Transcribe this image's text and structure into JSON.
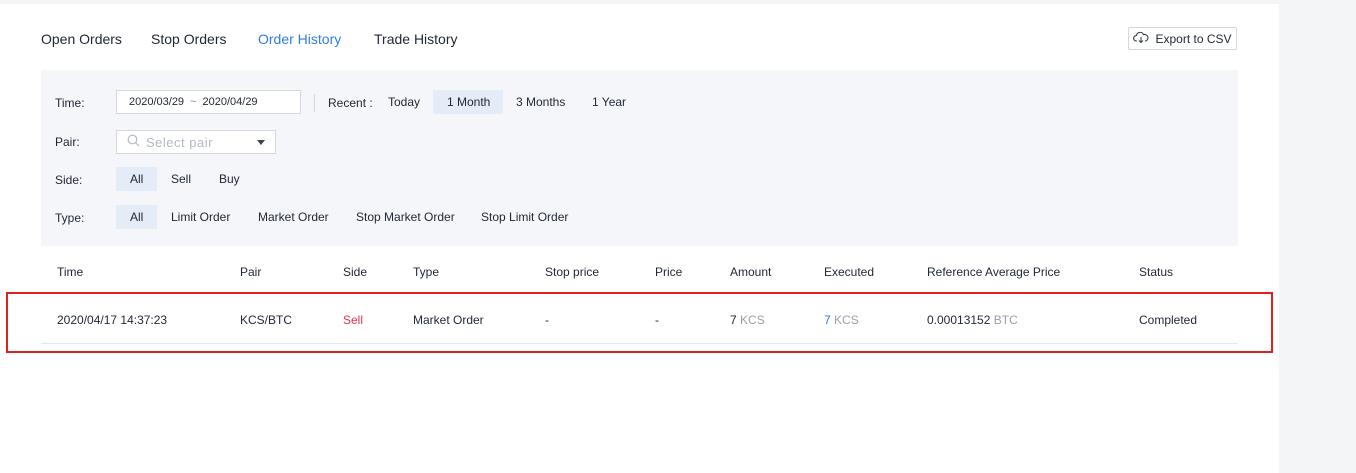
{
  "tabs": [
    {
      "label": "Open Orders"
    },
    {
      "label": "Stop Orders"
    },
    {
      "label": "Order History"
    },
    {
      "label": "Trade History"
    }
  ],
  "active_tab": "Order History",
  "export_label": "Export to CSV",
  "filters": {
    "time_label": "Time:",
    "date_from": "2020/03/29",
    "date_sep": "~",
    "date_to": "2020/04/29",
    "recent_label": "Recent :",
    "recent_options": [
      "Today",
      "1 Month",
      "3 Months",
      "1 Year"
    ],
    "recent_selected": "1 Month",
    "pair_label": "Pair:",
    "pair_placeholder": "Select  pair",
    "side_label": "Side:",
    "side_options": [
      "All",
      "Sell",
      "Buy"
    ],
    "side_selected": "All",
    "type_label": "Type:",
    "type_options": [
      "All",
      "Limit Order",
      "Market Order",
      "Stop Market Order",
      "Stop Limit Order"
    ],
    "type_selected": "All"
  },
  "table": {
    "headers": [
      "Time",
      "Pair",
      "Side",
      "Type",
      "Stop price",
      "Price",
      "Amount",
      "Executed",
      "Reference Average Price",
      "Status"
    ],
    "rows": [
      {
        "time": "2020/04/17 14:37:23",
        "pair": "KCS/BTC",
        "side": "Sell",
        "type": "Market Order",
        "stop_price": "-",
        "price": "-",
        "amount": "7",
        "amount_unit": "KCS",
        "executed": "7",
        "executed_unit": "KCS",
        "ref_avg_price": "0.00013152",
        "ref_avg_unit": "BTC",
        "status": "Completed"
      }
    ]
  },
  "colors": {
    "accent": "#2f7ee6",
    "sell": "#e8334b",
    "highlight_border": "#e01f1f",
    "selected_chip": "#e3ecf7",
    "filter_bg": "#f4f6f9"
  }
}
